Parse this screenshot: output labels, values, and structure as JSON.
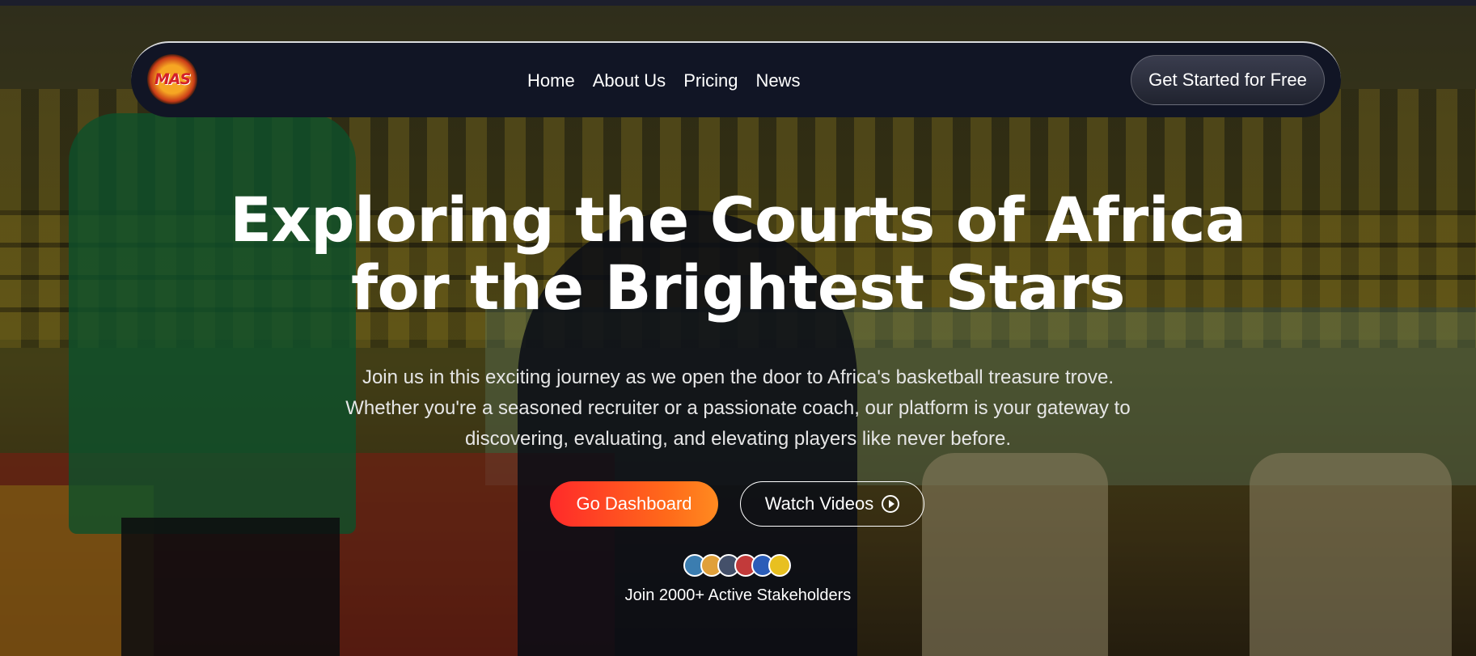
{
  "brand": {
    "logo_text": "MAS",
    "logo_icon": "basketball-logo-icon"
  },
  "nav": {
    "links": [
      "Home",
      "About Us",
      "Pricing",
      "News"
    ],
    "cta_label": "Get Started for Free"
  },
  "hero": {
    "title_line1": "Exploring the Courts of Africa",
    "title_line2": "for the Brightest Stars",
    "subtitle": "Join us in this exciting journey as we open the door to Africa's basketball treasure trove. Whether you're a seasoned recruiter or a passionate coach, our platform is your gateway to discovering, evaluating, and elevating players like never before.",
    "primary_button": "Go Dashboard",
    "secondary_button": "Watch Videos",
    "secondary_icon": "play-circle-icon",
    "avatar_colors": [
      "#3b7db0",
      "#e0a03a",
      "#44506a",
      "#c23a3a",
      "#2b5db8",
      "#e8c020"
    ],
    "social_proof": "Join 2000+ Active Stakeholders"
  },
  "colors": {
    "accent_start": "#ff2a2a",
    "accent_end": "#ff8a20",
    "nav_bg": "#111525"
  }
}
